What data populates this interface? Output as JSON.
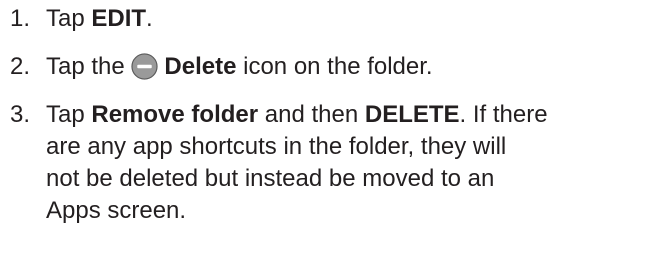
{
  "steps": [
    {
      "number": "1.",
      "parts": [
        "Tap ",
        "EDIT",
        "."
      ]
    },
    {
      "number": "2.",
      "parts": [
        "Tap the ",
        "Delete",
        " icon on the folder."
      ],
      "icon": "delete-icon"
    },
    {
      "number": "3.",
      "parts": [
        "Tap ",
        "Remove folder",
        " and then ",
        "DELETE",
        ". If there",
        "are any app shortcuts in the folder, they will",
        "not be deleted but instead be moved to an",
        "Apps screen."
      ]
    }
  ],
  "colors": {
    "text": "#231f20",
    "icon_fill": "#9a9a9a"
  }
}
